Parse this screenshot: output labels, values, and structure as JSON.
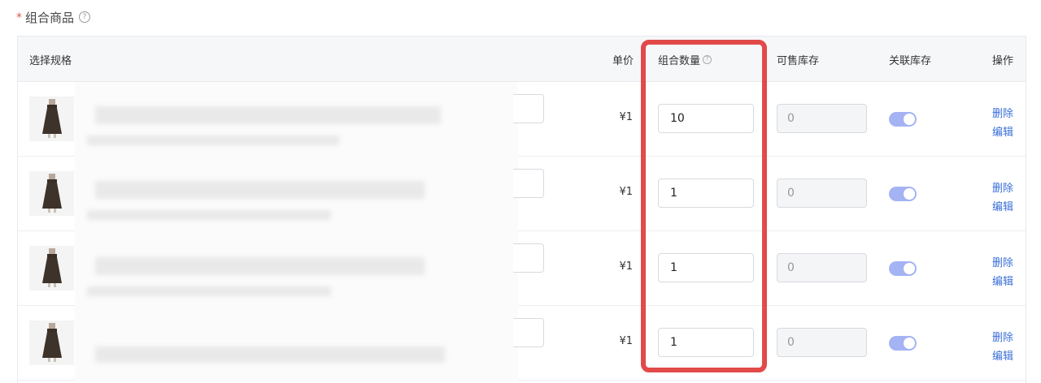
{
  "section": {
    "required_mark": "*",
    "title": "组合商品",
    "help": "?"
  },
  "table": {
    "headers": {
      "spec": "选择规格",
      "price": "单价",
      "quantity": "组合数量",
      "quantity_help": "?",
      "available_stock": "可售库存",
      "linked_stock": "关联库存",
      "actions": "操作"
    },
    "rows": [
      {
        "price": "¥1",
        "quantity": "10",
        "available_stock": "0",
        "linked_stock_on": true,
        "delete_label": "删除",
        "edit_label": "编辑"
      },
      {
        "price": "¥1",
        "quantity": "1",
        "available_stock": "0",
        "linked_stock_on": true,
        "delete_label": "删除",
        "edit_label": "编辑"
      },
      {
        "price": "¥1",
        "quantity": "1",
        "available_stock": "0",
        "linked_stock_on": true,
        "delete_label": "删除",
        "edit_label": "编辑"
      },
      {
        "price": "¥1",
        "quantity": "1",
        "available_stock": "0",
        "linked_stock_on": true,
        "delete_label": "删除",
        "edit_label": "编辑"
      }
    ]
  },
  "colors": {
    "accent": "#3a6fd8",
    "toggle_on": "#a4b3f3",
    "highlight": "#e24a4a",
    "required": "#e4534f"
  },
  "icons": {
    "help": "question-circle-icon",
    "thumbnail": "skirt-product-image"
  }
}
